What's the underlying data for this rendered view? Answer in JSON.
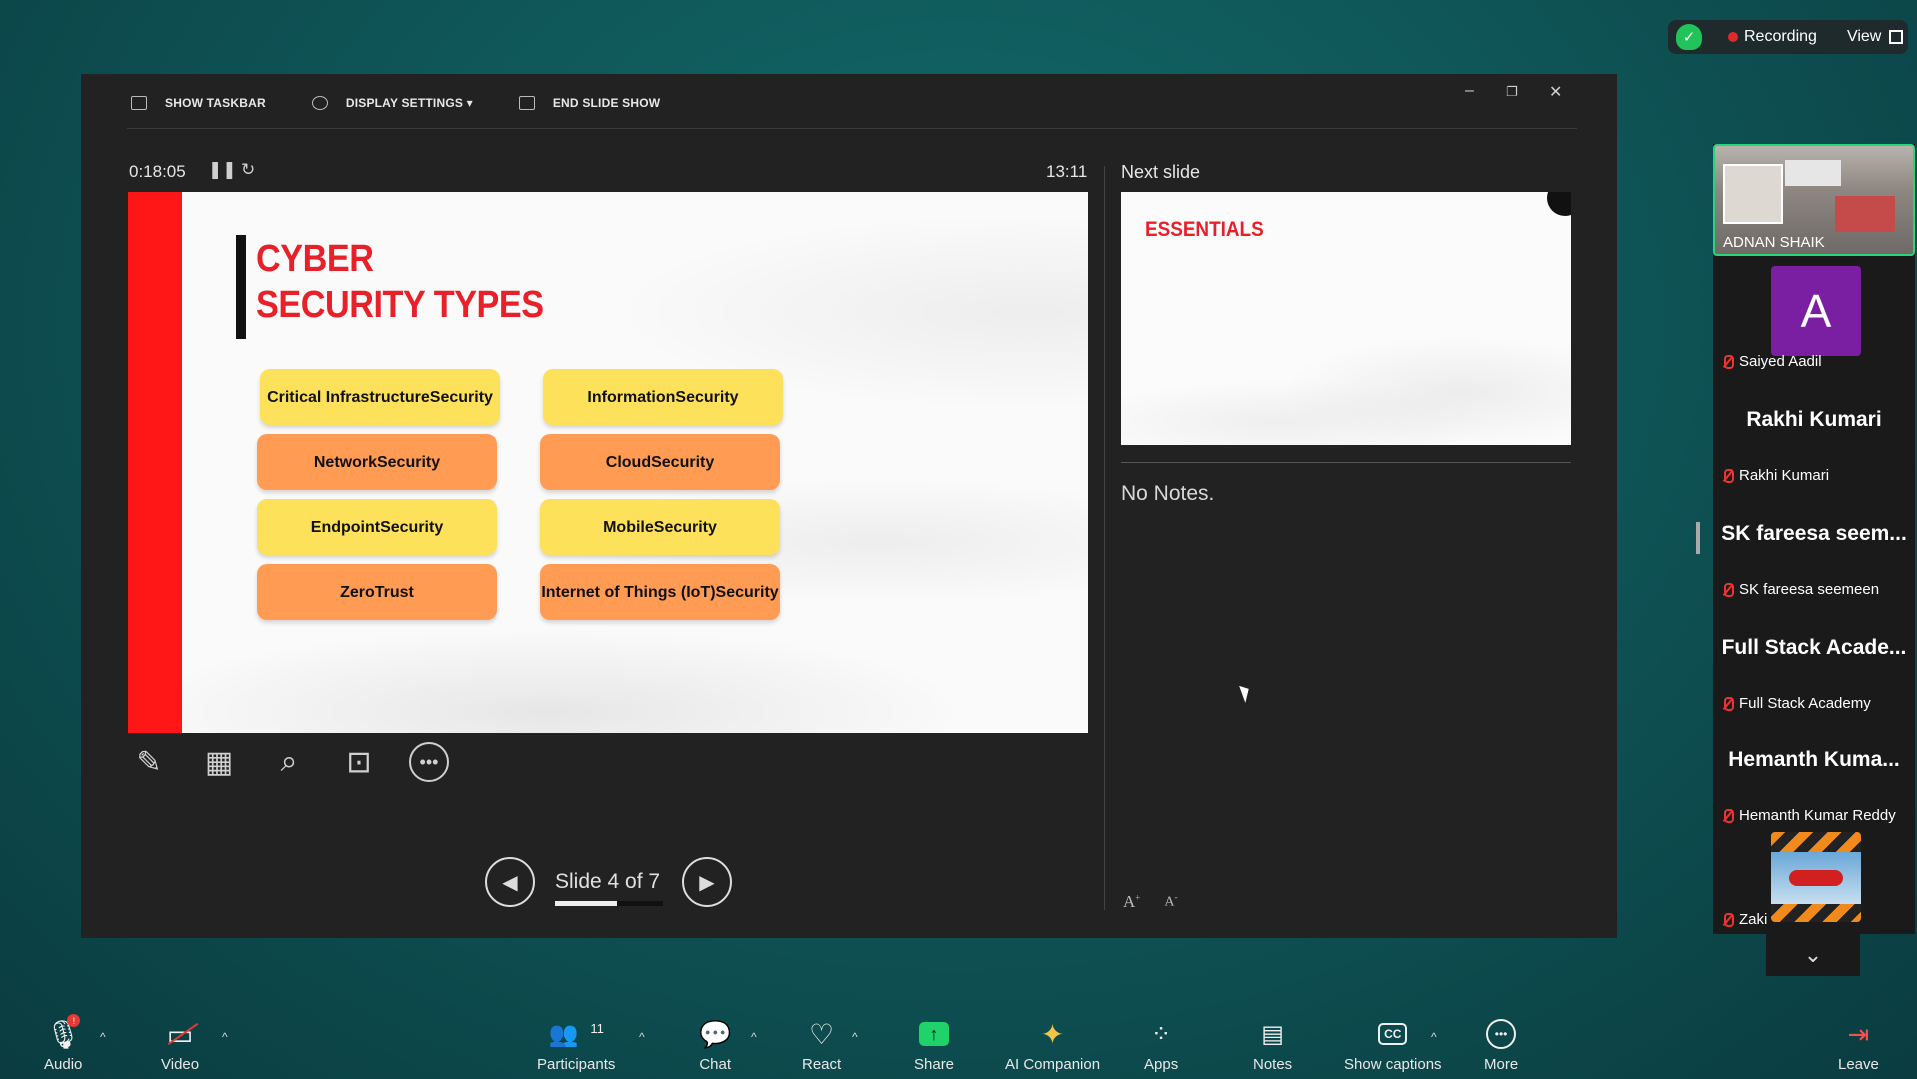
{
  "recording": {
    "label": "Recording",
    "view_label": "View"
  },
  "presenter": {
    "toolbar": {
      "show_taskbar": "SHOW TASKBAR",
      "display_settings": "DISPLAY SETTINGS ▾",
      "end_slide_show": "END SLIDE SHOW"
    },
    "elapsed": "0:18:05",
    "clock": "13:11",
    "current_slide": {
      "title_line1": "CYBER",
      "title_line2": "SECURITY TYPES",
      "items": [
        {
          "text": "Critical Infrastructure Security",
          "color": "yellow"
        },
        {
          "text": "Information Security",
          "color": "yellow"
        },
        {
          "text": "Network Security",
          "color": "orange"
        },
        {
          "text": "Cloud Security",
          "color": "orange"
        },
        {
          "text": "Endpoint Security",
          "color": "yellow"
        },
        {
          "text": "Mobile Security",
          "color": "yellow"
        },
        {
          "text": "Zero Trust",
          "color": "orange"
        },
        {
          "text": "Internet of Things (IoT) Security",
          "color": "orange"
        }
      ]
    },
    "slide_position": "Slide 4 of 7",
    "slide_progress": 0.57,
    "next_slide_label": "Next slide",
    "next_slide_title": "ESSENTIALS",
    "notes": "No Notes."
  },
  "participants": [
    {
      "name": "ADNAN SHAIK",
      "type": "video",
      "active": true
    },
    {
      "name": "Saiyed Aadil",
      "type": "avatar",
      "initial": "A",
      "avatar_color": "#7b1fa2"
    },
    {
      "name": "Rakhi Kumari",
      "type": "name",
      "display": "Rakhi Kumari"
    },
    {
      "name": "SK fareesa seemeen",
      "type": "name",
      "display": "SK fareesa seem..."
    },
    {
      "name": "Full Stack Academy",
      "type": "name",
      "display": "Full Stack Acade..."
    },
    {
      "name": "Hemanth Kumar Reddy",
      "type": "name",
      "display": "Hemanth Kuma..."
    },
    {
      "name": "Zaki",
      "type": "image"
    }
  ],
  "meeting_bar": {
    "audio": "Audio",
    "video": "Video",
    "participants": "Participants",
    "participants_count": "11",
    "chat": "Chat",
    "react": "React",
    "share": "Share",
    "ai_companion": "AI Companion",
    "apps": "Apps",
    "notes": "Notes",
    "show_captions": "Show captions",
    "more": "More",
    "leave": "Leave"
  },
  "colors": {
    "slide_red": "#ff1616",
    "title_red": "#e8202a",
    "chip_yellow": "#fde15a",
    "chip_orange": "#ff9b52",
    "share_green": "#1fd26a"
  }
}
